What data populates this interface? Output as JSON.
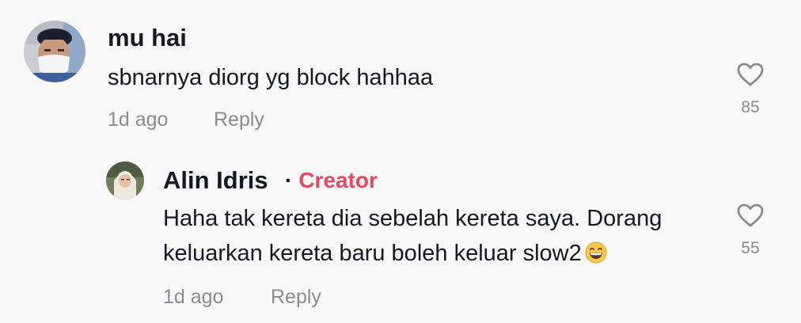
{
  "comments": [
    {
      "username": "mu hai",
      "text": "sbnarnya diorg yg block hahhaa",
      "time": "1d ago",
      "reply_label": "Reply",
      "likes": "85",
      "avatar": "avatar-photo-masked-man"
    }
  ],
  "reply": {
    "username": "Alin Idris",
    "separator": "·",
    "badge": "Creator",
    "text_line1": "Haha tak kereta dia sebelah kereta saya. Dorang",
    "text_line2": "keluarkan kereta baru boleh keluar slow2",
    "emoji": "grinning-face-emoji",
    "time": "1d ago",
    "reply_label": "Reply",
    "likes": "55",
    "avatar": "avatar-photo-woman-hijab"
  },
  "colors": {
    "background": "#f8f8f8",
    "text_primary": "#161823",
    "text_secondary": "#8a8b91",
    "creator_badge": "#e8485e"
  }
}
